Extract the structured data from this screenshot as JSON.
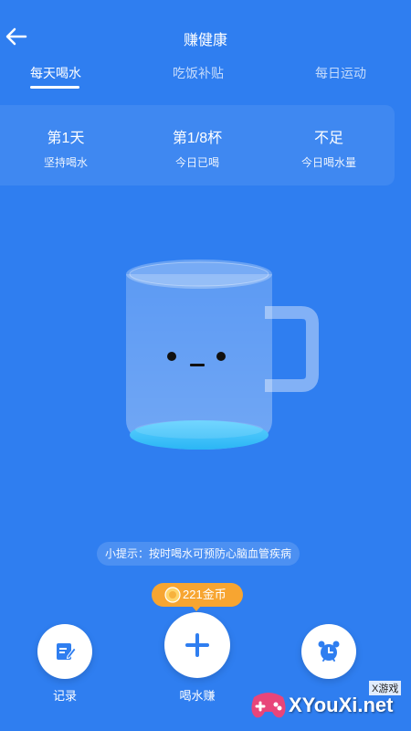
{
  "header": {
    "title": "赚健康"
  },
  "tabs": [
    {
      "label": "每天喝水",
      "active": true
    },
    {
      "label": "吃饭补贴",
      "active": false
    },
    {
      "label": "每日运动",
      "active": false
    }
  ],
  "stats": [
    {
      "value": "第1天",
      "label": "坚持喝水"
    },
    {
      "value": "第1/8杯",
      "label": "今日已喝"
    },
    {
      "value": "不足",
      "label": "今日喝水量"
    }
  ],
  "tip": "小提示：按时喝水可预防心脑血管疾病",
  "coins": {
    "text": "221金币"
  },
  "actions": [
    {
      "label": "记录",
      "icon": "edit-icon"
    },
    {
      "label": "喝水赚",
      "icon": "plus-icon"
    },
    {
      "label": "",
      "icon": "alarm-clock-icon"
    }
  ],
  "watermark": {
    "tag": "X游戏",
    "text": "XYouXi.net"
  },
  "colors": {
    "background": "#2f7ef0",
    "accent": "#2f7ef0",
    "coin_badge": "#f7a531"
  }
}
